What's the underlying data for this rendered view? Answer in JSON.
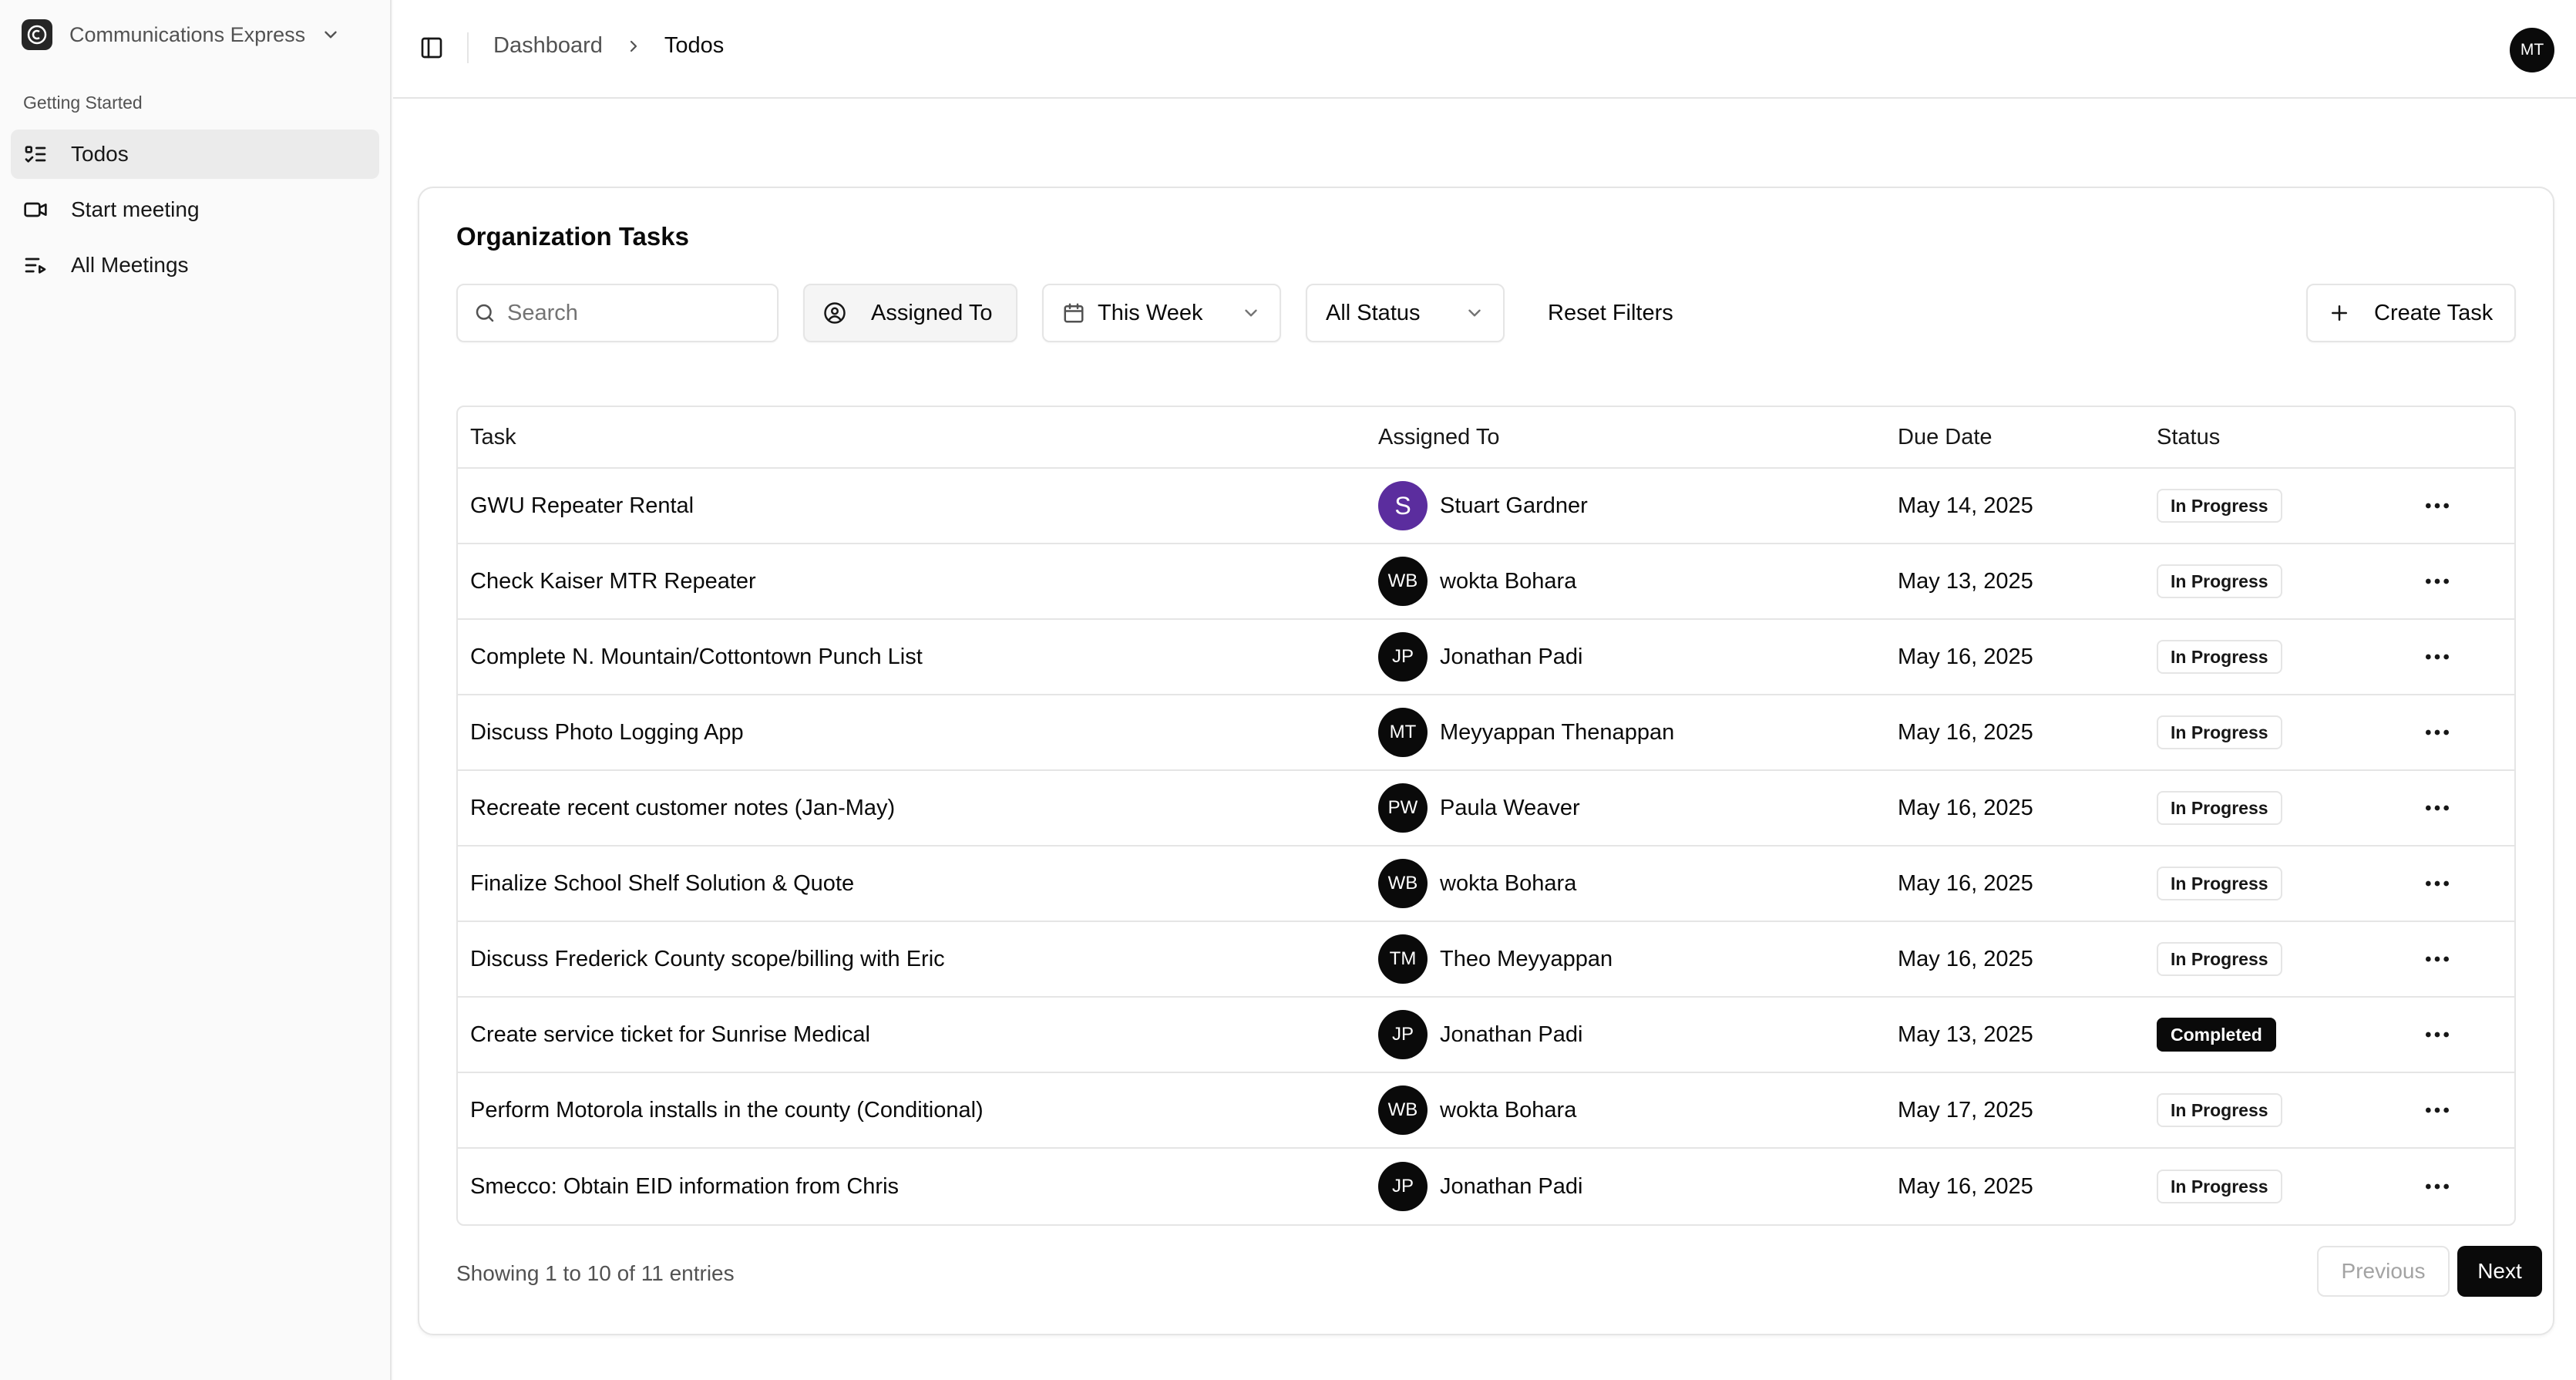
{
  "sidebar": {
    "org_name": "Communications Express",
    "section_label": "Getting Started",
    "items": [
      {
        "label": "Todos",
        "icon": "list-todo-icon",
        "active": true
      },
      {
        "label": "Start meeting",
        "icon": "video-icon",
        "active": false
      },
      {
        "label": "All Meetings",
        "icon": "list-video-icon",
        "active": false
      }
    ]
  },
  "header": {
    "breadcrumb": [
      "Dashboard",
      "Todos"
    ],
    "user_initials": "MT"
  },
  "card": {
    "title": "Organization Tasks",
    "filters": {
      "search_placeholder": "Search",
      "assigned_label": "Assigned To",
      "week_label": "This Week",
      "status_label": "All Status",
      "reset_label": "Reset Filters",
      "create_label": "Create Task"
    },
    "table": {
      "headers": [
        "Task",
        "Assigned To",
        "Due Date",
        "Status"
      ],
      "rows": [
        {
          "task": "GWU Repeater Rental",
          "initials": "S",
          "assignee": "Stuart Gardner",
          "due": "May 14, 2025",
          "status": "In Progress"
        },
        {
          "task": "Check Kaiser MTR Repeater",
          "initials": "WB",
          "assignee": "wokta Bohara",
          "due": "May 13, 2025",
          "status": "In Progress"
        },
        {
          "task": "Complete N. Mountain/Cottontown Punch List",
          "initials": "JP",
          "assignee": "Jonathan Padi",
          "due": "May 16, 2025",
          "status": "In Progress"
        },
        {
          "task": "Discuss Photo Logging App",
          "initials": "MT",
          "assignee": "Meyyappan Thenappan",
          "due": "May 16, 2025",
          "status": "In Progress"
        },
        {
          "task": "Recreate recent customer notes (Jan-May)",
          "initials": "PW",
          "assignee": "Paula Weaver",
          "due": "May 16, 2025",
          "status": "In Progress"
        },
        {
          "task": "Finalize School Shelf Solution & Quote",
          "initials": "WB",
          "assignee": "wokta Bohara",
          "due": "May 16, 2025",
          "status": "In Progress"
        },
        {
          "task": "Discuss Frederick County scope/billing with Eric",
          "initials": "TM",
          "assignee": "Theo Meyyappan",
          "due": "May 16, 2025",
          "status": "In Progress"
        },
        {
          "task": "Create service ticket for Sunrise Medical",
          "initials": "JP",
          "assignee": "Jonathan Padi",
          "due": "May 13, 2025",
          "status": "Completed"
        },
        {
          "task": "Perform Motorola installs in the county (Conditional)",
          "initials": "WB",
          "assignee": "wokta Bohara",
          "due": "May 17, 2025",
          "status": "In Progress"
        },
        {
          "task": "Smecco: Obtain EID information from Chris",
          "initials": "JP",
          "assignee": "Jonathan Padi",
          "due": "May 16, 2025",
          "status": "In Progress"
        }
      ]
    },
    "footer": {
      "info": "Showing 1 to 10 of 11 entries",
      "prev_label": "Previous",
      "next_label": "Next"
    }
  },
  "colors": {
    "accent": "#0a0a0a",
    "avatar_purple": "#5b2d9e",
    "border": "#e5e5e5",
    "muted_text": "#525252"
  }
}
